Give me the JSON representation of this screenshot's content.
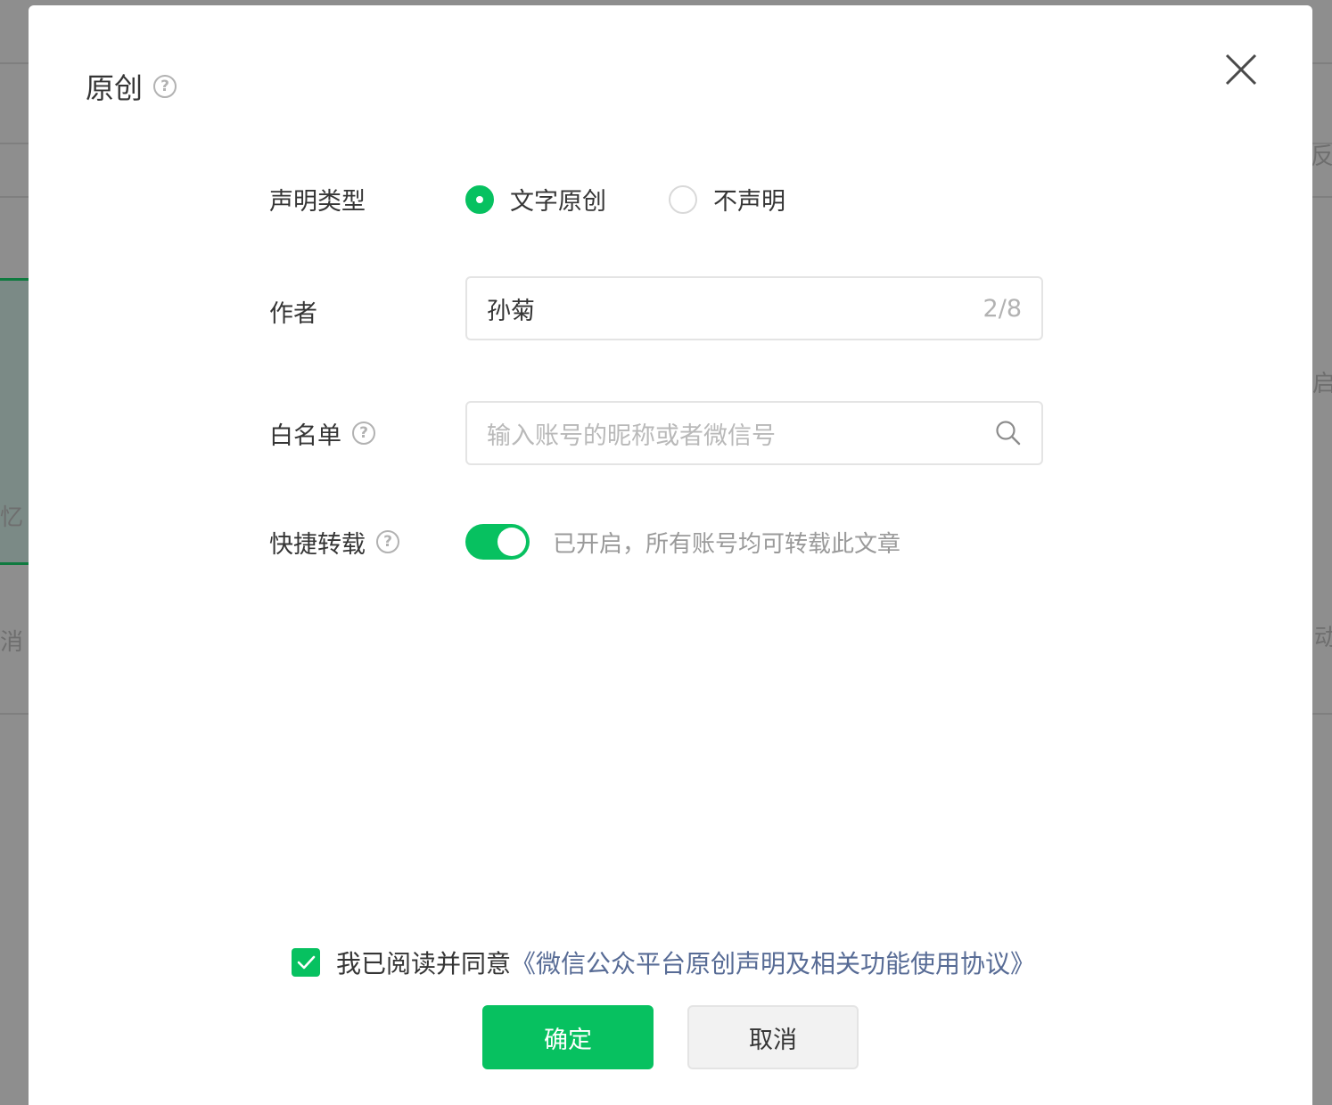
{
  "background": {
    "frag_left_1": "忆",
    "frag_left_2": "消",
    "frag_right_1": "反",
    "frag_right_2": "启",
    "frag_right_3": "动"
  },
  "modal": {
    "title": "原创",
    "title_help": "?",
    "close_icon": "close-icon"
  },
  "form": {
    "declare_type": {
      "label": "声明类型",
      "options": [
        {
          "label": "文字原创",
          "checked": true
        },
        {
          "label": "不声明",
          "checked": false
        }
      ]
    },
    "author": {
      "label": "作者",
      "value": "孙菊",
      "counter": "2/8"
    },
    "whitelist": {
      "label": "白名单",
      "help": "?",
      "placeholder": "输入账号的昵称或者微信号"
    },
    "quick_repost": {
      "label": "快捷转载",
      "help": "?",
      "enabled": true,
      "description": "已开启，所有账号均可转载此文章"
    }
  },
  "agreement": {
    "checked": true,
    "text": "我已阅读并同意",
    "link": "《微信公众平台原创声明及相关功能使用协议》"
  },
  "buttons": {
    "confirm": "确定",
    "cancel": "取消"
  },
  "colors": {
    "accent": "#07c160",
    "link": "#576b95"
  }
}
